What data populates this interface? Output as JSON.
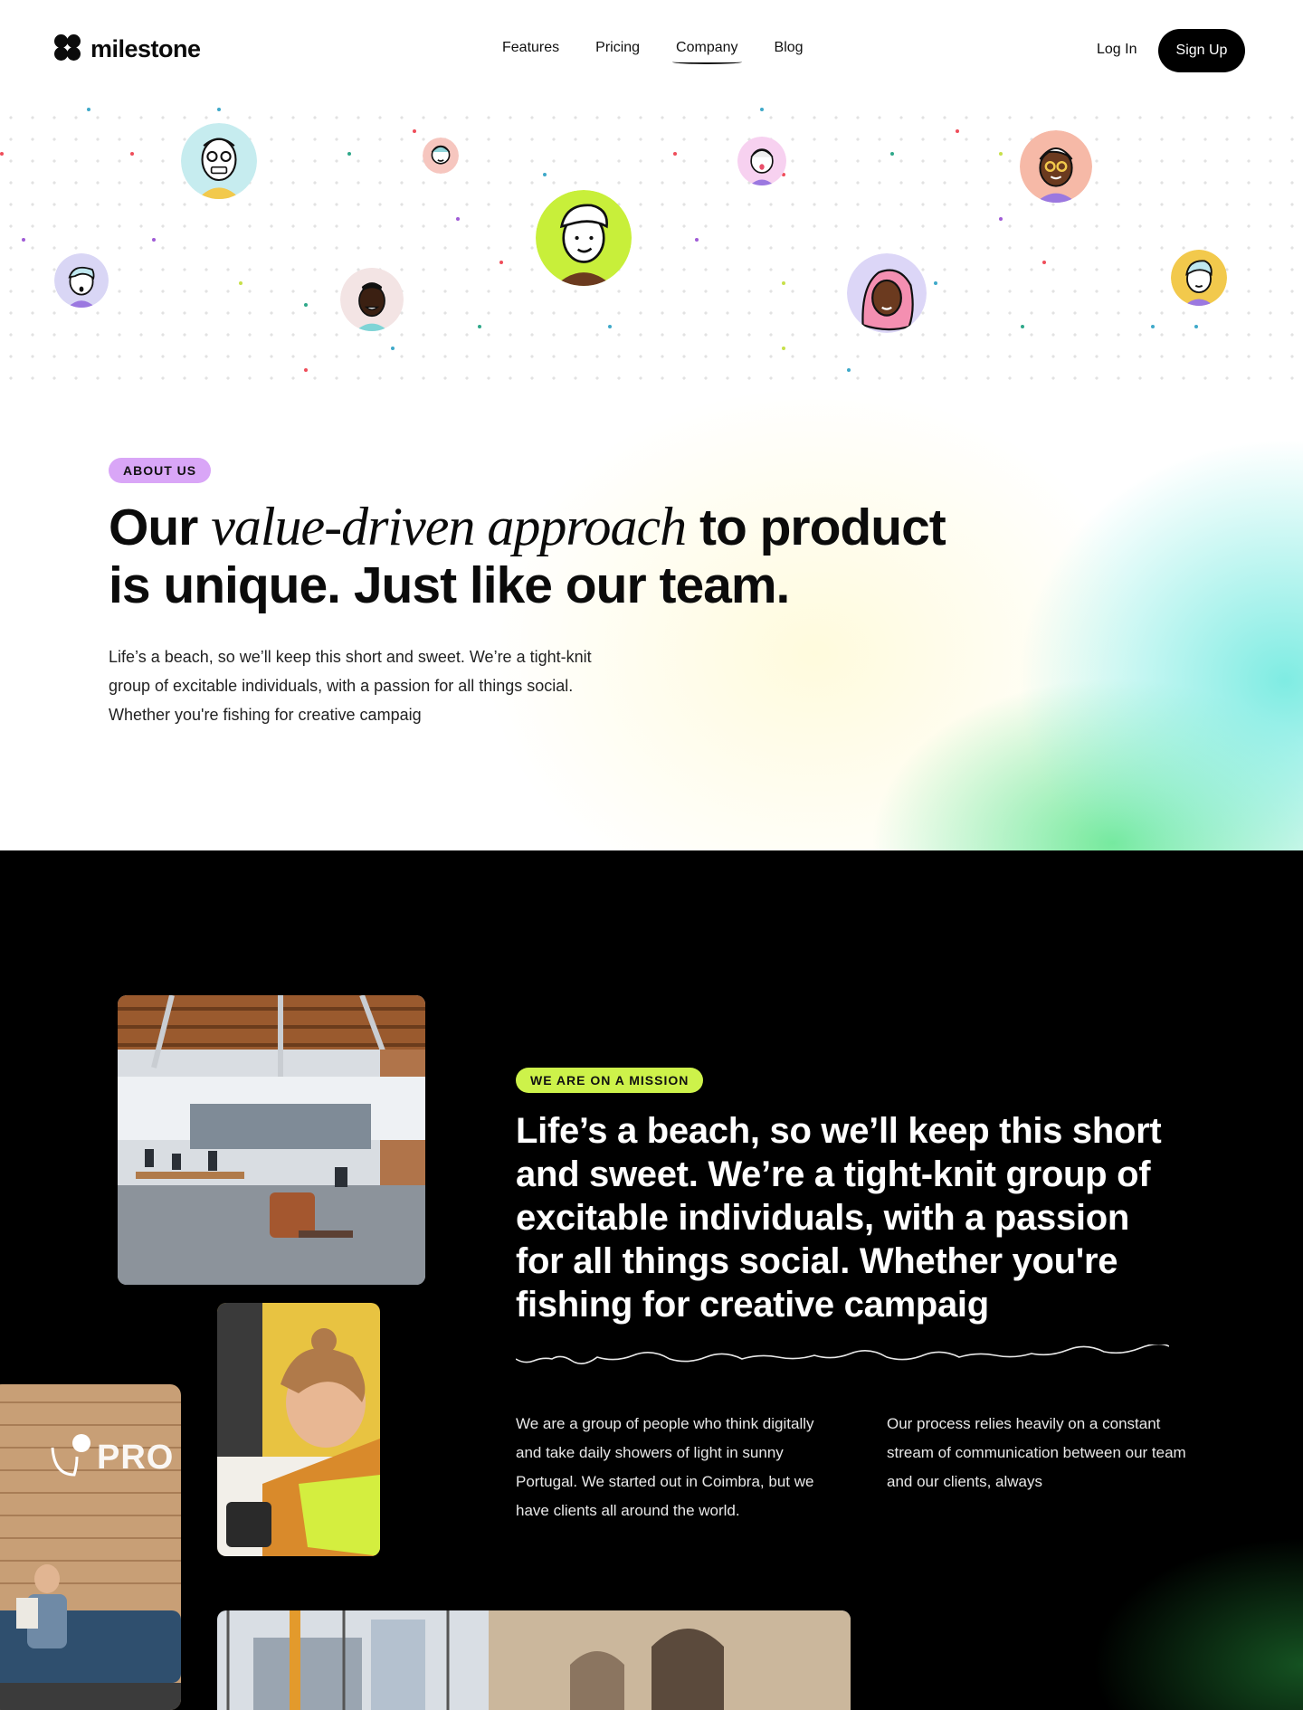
{
  "brand": {
    "name": "milestone"
  },
  "nav": {
    "links": [
      "Features",
      "Pricing",
      "Company",
      "Blog"
    ],
    "active": "Company",
    "login_label": "Log In",
    "signup_label": "Sign Up"
  },
  "about": {
    "badge": "ABOUT US",
    "title_start": "Our ",
    "title_emphasis": "value-driven approach",
    "title_end": " to product is unique. Just like our team.",
    "body": "Life’s a beach, so we’ll keep this short and sweet. We’re a tight-knit group of excitable individuals, with a passion for all things social. Whether you're fishing for creative campaig"
  },
  "mission": {
    "badge": "WE ARE ON A MISSION",
    "title": "Life’s a beach, so we’ll keep this short and sweet. We’re a tight-knit group of excitable individuals, with a passion for all things social. Whether you're fishing for creative campaig",
    "column_1": "We are a group of people who think digitally and take daily showers of light in sunny Portugal. We started out in Coimbra, but we have clients all around the world.",
    "column_2": "Our process relies heavily on a constant stream of communication between our team and our clients, always",
    "photo_wall_text": "PRO"
  },
  "colors": {
    "about_badge": "#d9a6f7",
    "mission_badge": "#cdf24a",
    "signup_bg": "#000000",
    "mission_bg": "#000000"
  }
}
